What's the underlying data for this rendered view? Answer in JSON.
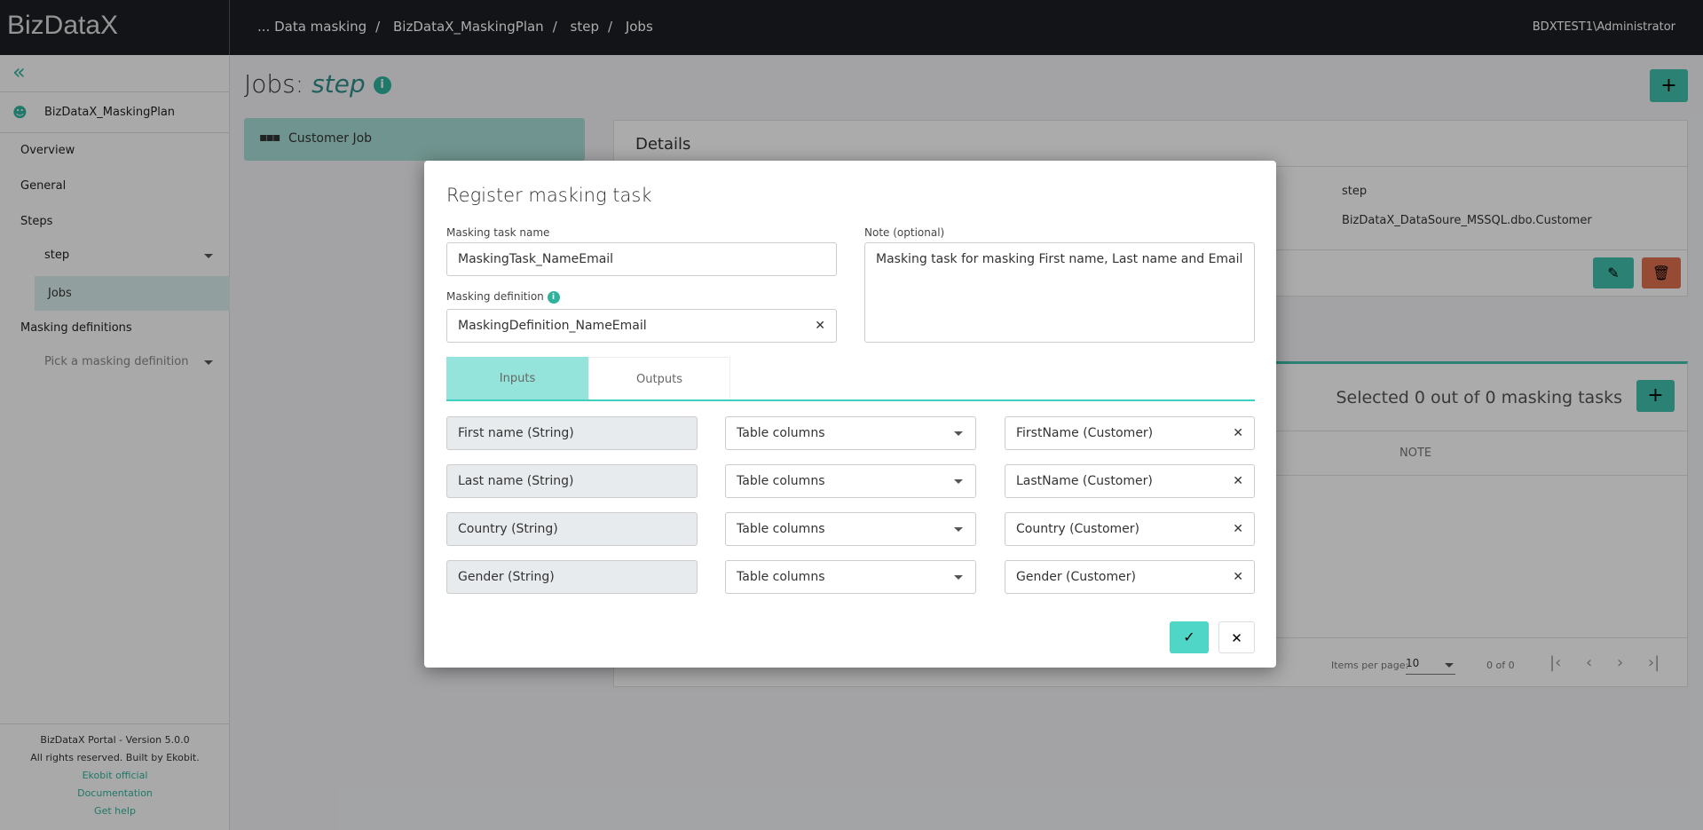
{
  "app": {
    "logo": "BizDataX",
    "user": "BDXTEST1\\Administrator"
  },
  "breadcrumb": [
    "... Data masking",
    "BizDataX_MaskingPlan",
    "step",
    "Jobs"
  ],
  "sidebar": {
    "plan": "BizDataX_MaskingPlan",
    "items": {
      "overview": "Overview",
      "general": "General",
      "steps": "Steps",
      "step": "step",
      "jobs": "Jobs",
      "masking_definitions": "Masking definitions",
      "pick": "Pick a masking definition"
    },
    "footer": {
      "version": "BizDataX Portal - Version 5.0.0",
      "rights": "All rights reserved. Built by Ekobit.",
      "links": [
        "Ekobit official",
        "Documentation",
        "Get help"
      ]
    }
  },
  "main": {
    "title_prefix": "Jobs:",
    "title_name": "step",
    "job_card": "Customer Job",
    "details": {
      "title": "Details",
      "values": [
        "step",
        "BizDataX_DataSoure_MSSQL.dbo.Customer"
      ]
    },
    "tasks": {
      "selected": "Selected 0 out of 0 masking tasks",
      "column_note": "NOTE",
      "items_per_page_label": "Items per page:",
      "items_per_page": "10",
      "range": "0 of 0"
    }
  },
  "modal": {
    "title": "Register masking task",
    "task_name_label": "Masking task name",
    "task_name": "MaskingTask_NameEmail",
    "note_label": "Note (optional)",
    "note": "Masking task for masking First name, Last name and Email",
    "definition_label": "Masking definition",
    "definition": "MaskingDefinition_NameEmail",
    "tabs": [
      "Inputs",
      "Outputs"
    ],
    "active_tab": "Inputs",
    "rows": [
      {
        "param": "First name (String)",
        "source": "Table columns",
        "value": "FirstName (Customer)"
      },
      {
        "param": "Last name (String)",
        "source": "Table columns",
        "value": "LastName (Customer)"
      },
      {
        "param": "Country (String)",
        "source": "Table columns",
        "value": "Country (Customer)"
      },
      {
        "param": "Gender (String)",
        "source": "Table columns",
        "value": "Gender (Customer)"
      }
    ]
  },
  "colors": {
    "accent": "#3fc1ad",
    "danger": "#e0714f",
    "topbar": "#1d1f24"
  }
}
